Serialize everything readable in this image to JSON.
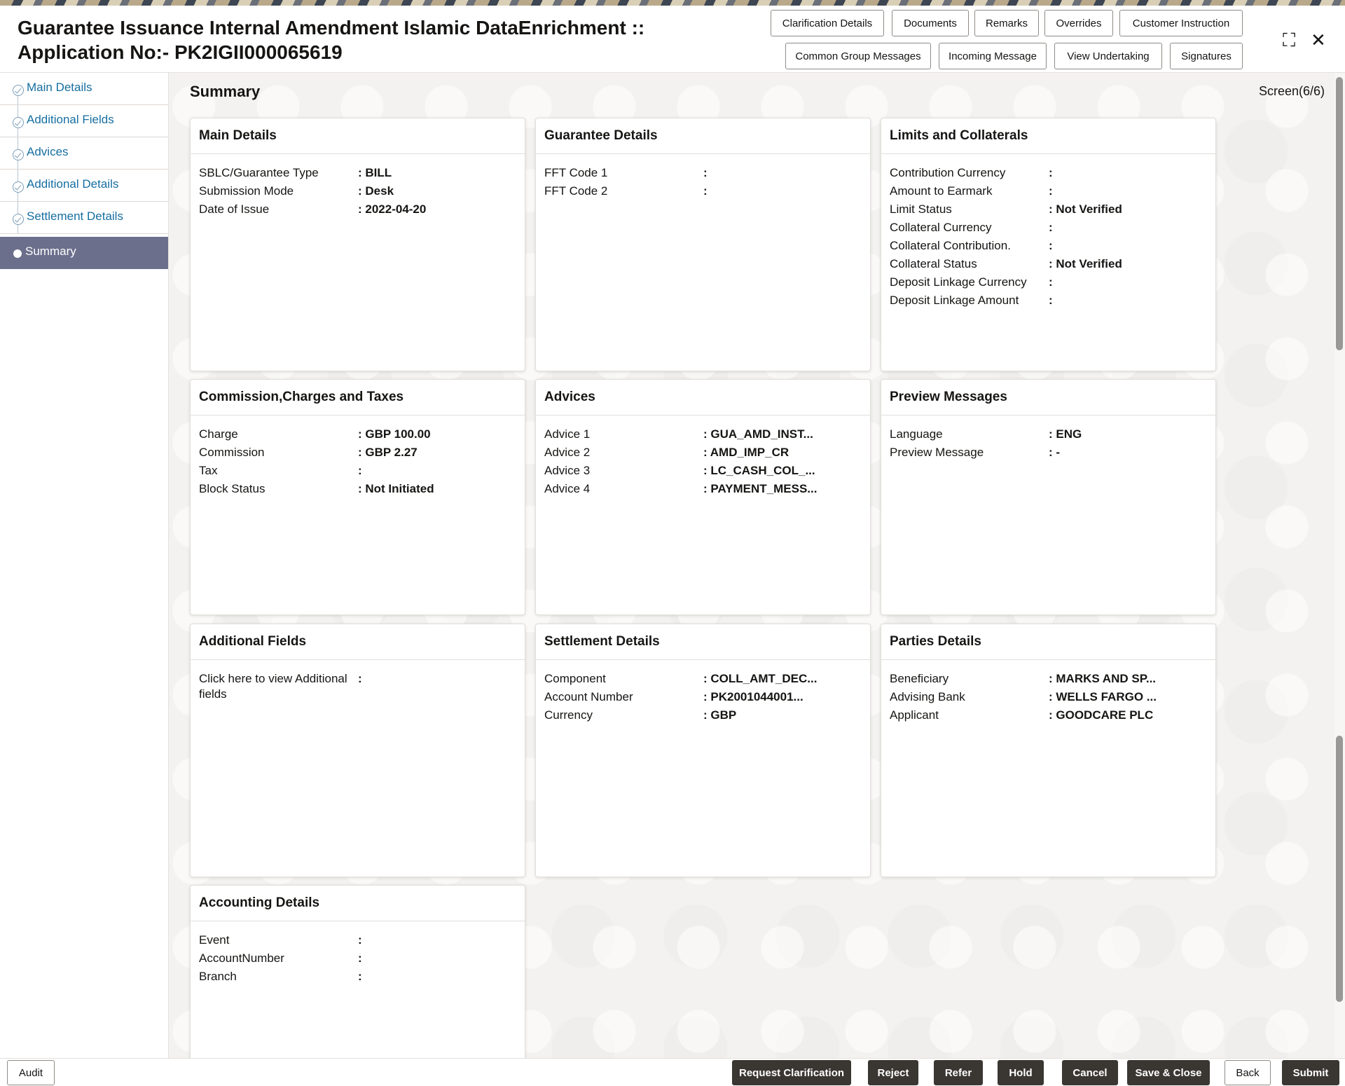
{
  "header": {
    "title_line1": "Guarantee Issuance Internal Amendment Islamic DataEnrichment ::",
    "title_line2": "Application No:- PK2IGII000065619",
    "buttons_row1": [
      "Clarification Details",
      "Documents",
      "Remarks",
      "Overrides",
      "Customer Instruction"
    ],
    "buttons_row2": [
      "Common Group Messages",
      "Incoming Message",
      "View Undertaking",
      "Signatures"
    ],
    "minimize_glyph": "⛶",
    "close_glyph": "✕"
  },
  "sidebar": {
    "items": [
      {
        "label": "Main Details",
        "state": "done"
      },
      {
        "label": "Additional Fields",
        "state": "done"
      },
      {
        "label": "Advices",
        "state": "done"
      },
      {
        "label": "Additional Details",
        "state": "done"
      },
      {
        "label": "Settlement Details",
        "state": "done"
      },
      {
        "label": "Summary",
        "state": "active"
      }
    ]
  },
  "main": {
    "title": "Summary",
    "screen_indicator": "Screen(6/6)",
    "cards": [
      {
        "title": "Main Details",
        "rows": [
          {
            "label": "SBLC/Guarantee Type",
            "value": ": BILL"
          },
          {
            "label": "Submission Mode",
            "value": ": Desk"
          },
          {
            "label": "Date of Issue",
            "value": ": 2022-04-20"
          }
        ]
      },
      {
        "title": "Guarantee Details",
        "rows": [
          {
            "label": "FFT Code 1",
            "value": ":"
          },
          {
            "label": "FFT Code 2",
            "value": ":"
          }
        ]
      },
      {
        "title": "Limits and Collaterals",
        "rows": [
          {
            "label": "Contribution Currency",
            "value": ":"
          },
          {
            "label": "Amount to Earmark",
            "value": ":"
          },
          {
            "label": "Limit Status",
            "value": ": Not Verified"
          },
          {
            "label": "Collateral Currency",
            "value": ":"
          },
          {
            "label": "Collateral Contribution.",
            "value": ":"
          },
          {
            "label": "Collateral Status",
            "value": ": Not Verified"
          },
          {
            "label": "Deposit Linkage Currency",
            "value": ":"
          },
          {
            "label": "Deposit Linkage Amount",
            "value": ":"
          }
        ]
      },
      {
        "title": "Commission,Charges and Taxes",
        "rows": [
          {
            "label": "Charge",
            "value": ": GBP  100.00"
          },
          {
            "label": "Commission",
            "value": ": GBP  2.27"
          },
          {
            "label": "Tax",
            "value": ":"
          },
          {
            "label": "Block Status",
            "value": ": Not Initiated"
          }
        ]
      },
      {
        "title": "Advices",
        "rows": [
          {
            "label": "Advice 1",
            "value": ": GUA_AMD_INST..."
          },
          {
            "label": "Advice 2",
            "value": ": AMD_IMP_CR"
          },
          {
            "label": "Advice 3",
            "value": ": LC_CASH_COL_..."
          },
          {
            "label": "Advice 4",
            "value": ": PAYMENT_MESS..."
          }
        ]
      },
      {
        "title": "Preview Messages",
        "rows": [
          {
            "label": "Language",
            "value": ": ENG"
          },
          {
            "label": "Preview Message",
            "value": ": -"
          }
        ]
      },
      {
        "title": "Additional Fields",
        "rows": [
          {
            "label": "Click here to view Additional fields",
            "value": ":"
          }
        ]
      },
      {
        "title": "Settlement Details",
        "rows": [
          {
            "label": "Component",
            "value": ": COLL_AMT_DEC..."
          },
          {
            "label": "Account Number",
            "value": ": PK2001044001..."
          },
          {
            "label": "Currency",
            "value": ": GBP"
          }
        ]
      },
      {
        "title": "Parties Details",
        "rows": [
          {
            "label": "Beneficiary",
            "value": ": MARKS AND SP..."
          },
          {
            "label": "Advising Bank",
            "value": ": WELLS FARGO ..."
          },
          {
            "label": "Applicant",
            "value": ": GOODCARE PLC"
          }
        ]
      },
      {
        "title": "Accounting Details",
        "rows": [
          {
            "label": "Event",
            "value": ":"
          },
          {
            "label": "AccountNumber",
            "value": ":"
          },
          {
            "label": "Branch",
            "value": ":"
          }
        ]
      }
    ]
  },
  "footer": {
    "audit_label": "Audit",
    "actions": [
      "Request Clarification",
      "Reject",
      "Refer",
      "Hold",
      "Cancel",
      "Save & Close",
      "Back",
      "Submit"
    ]
  },
  "colors": {
    "active_nav": "#6b6f8c",
    "link": "#166ea0",
    "dark_button": "#3a3632"
  }
}
